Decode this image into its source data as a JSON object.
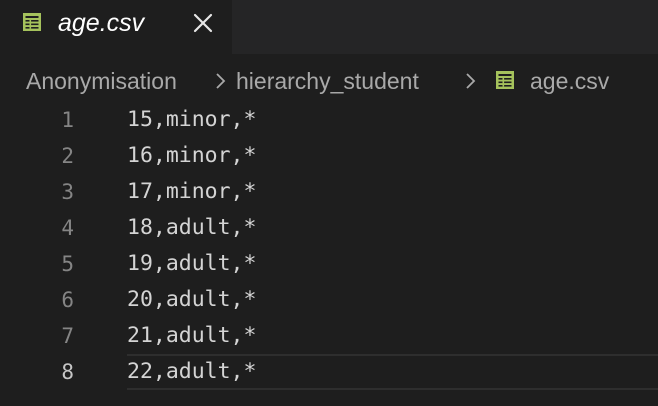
{
  "tab": {
    "label": "age.csv",
    "icon": "csv-table-icon",
    "close_icon": "close-icon"
  },
  "breadcrumb": {
    "items": [
      "Anonymisation",
      "hierarchy_student",
      "age.csv"
    ]
  },
  "editor": {
    "current_line": 8,
    "lines": [
      {
        "number": "1",
        "text": "15,minor,*"
      },
      {
        "number": "2",
        "text": "16,minor,*"
      },
      {
        "number": "3",
        "text": "17,minor,*"
      },
      {
        "number": "4",
        "text": "18,adult,*"
      },
      {
        "number": "5",
        "text": "19,adult,*"
      },
      {
        "number": "6",
        "text": "20,adult,*"
      },
      {
        "number": "7",
        "text": "21,adult,*"
      },
      {
        "number": "8",
        "text": "22,adult,*"
      }
    ]
  },
  "colors": {
    "background": "#1e1e1e",
    "tabbar": "#252526",
    "icon_green": "#a5c25c",
    "line_number": "#858585",
    "text": "#d4d4d4"
  }
}
